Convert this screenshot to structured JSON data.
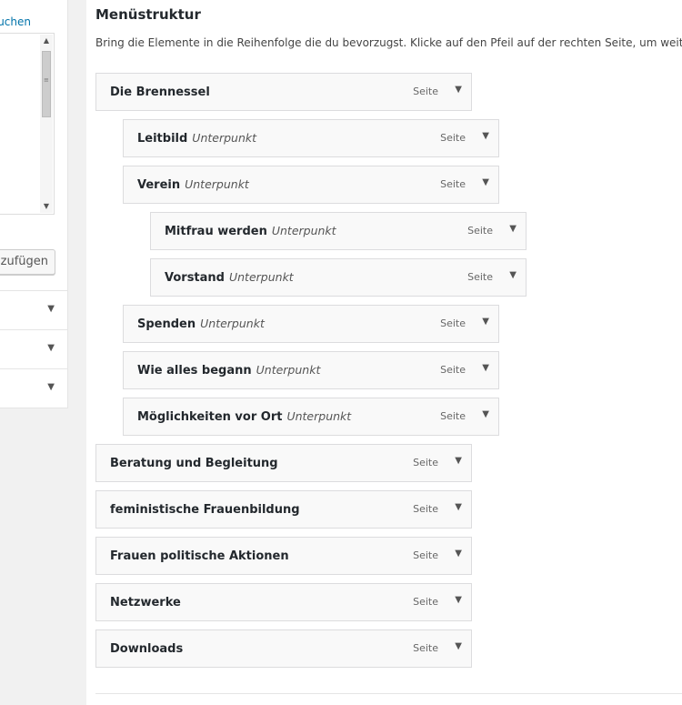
{
  "left_panel": {
    "search_link": "uchen",
    "add_button": "nzufügen",
    "scroll_up_glyph": "▲",
    "scroll_down_glyph": "▼",
    "scroll_grip_glyph": "≡",
    "accordion_arrow_glyph": "▼"
  },
  "main": {
    "title": "Menüstruktur",
    "description": "Bring die Elemente in die Reihenfolge die du bevorzugst. Klicke auf den Pfeil auf der rechten Seite, um weitere",
    "toggle_glyph": "▼",
    "items": [
      {
        "label": "Die Brennessel",
        "sub": "",
        "type": "Seite",
        "depth": 0
      },
      {
        "label": "Leitbild",
        "sub": "Unterpunkt",
        "type": "Seite",
        "depth": 1
      },
      {
        "label": "Verein",
        "sub": "Unterpunkt",
        "type": "Seite",
        "depth": 1
      },
      {
        "label": "Mitfrau werden",
        "sub": "Unterpunkt",
        "type": "Seite",
        "depth": 2
      },
      {
        "label": "Vorstand",
        "sub": "Unterpunkt",
        "type": "Seite",
        "depth": 2
      },
      {
        "label": "Spenden",
        "sub": "Unterpunkt",
        "type": "Seite",
        "depth": 1
      },
      {
        "label": "Wie alles begann",
        "sub": "Unterpunkt",
        "type": "Seite",
        "depth": 1
      },
      {
        "label": "Möglichkeiten vor Ort",
        "sub": "Unterpunkt",
        "type": "Seite",
        "depth": 1
      },
      {
        "label": "Beratung und Begleitung",
        "sub": "",
        "type": "Seite",
        "depth": 0
      },
      {
        "label": "feministische Frauenbildung",
        "sub": "",
        "type": "Seite",
        "depth": 0
      },
      {
        "label": "Frauen politische Aktionen",
        "sub": "",
        "type": "Seite",
        "depth": 0
      },
      {
        "label": "Netzwerke",
        "sub": "",
        "type": "Seite",
        "depth": 0
      },
      {
        "label": "Downloads",
        "sub": "",
        "type": "Seite",
        "depth": 0
      }
    ]
  }
}
